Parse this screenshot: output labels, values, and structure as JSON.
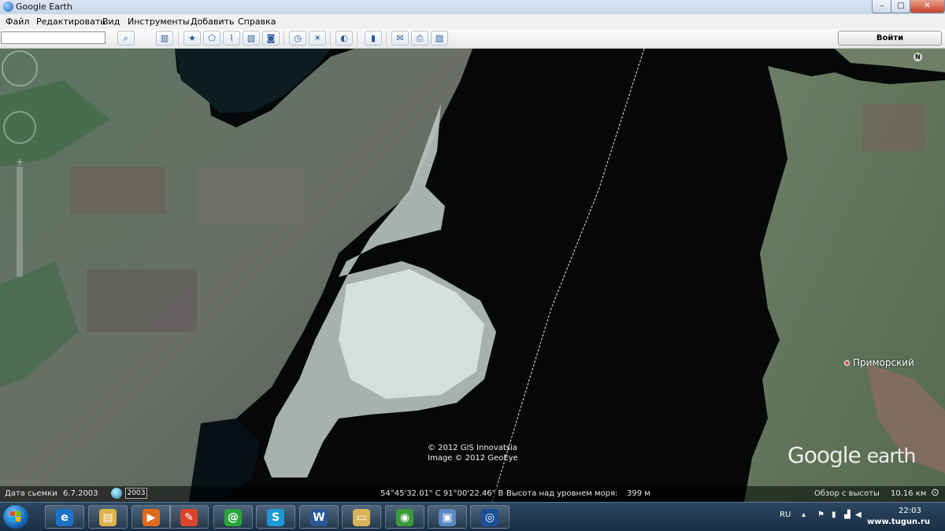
{
  "window": {
    "title": "Google Earth",
    "controls": {
      "minimize": "–",
      "maximize": "□",
      "close": "✕"
    }
  },
  "menu": [
    "Файл",
    "Редактировать",
    "Вид",
    "Инструменты",
    "Добавить",
    "Справка"
  ],
  "toolbar": {
    "search_value": "",
    "login_label": "Войти",
    "icons": [
      "search-icon",
      "sidebar-icon",
      "placemark-icon",
      "polygon-icon",
      "path-icon",
      "image-overlay-icon",
      "record-tour-icon",
      "historical-imagery-icon",
      "sunlight-icon",
      "planets-icon",
      "ruler-icon",
      "email-icon",
      "print-icon",
      "save-image-icon"
    ]
  },
  "map": {
    "copyright": [
      "© 2012 GIS Innovatsia",
      "Image © 2012 GeoEye"
    ],
    "place_label": "Приморский",
    "logo_main": "Google",
    "logo_sub": "earth",
    "north_label": "N"
  },
  "status": {
    "date_label": "Дата сьемки",
    "date_value": "6.7.2003",
    "year": "2003",
    "coordinates": "54°45'32.01\" С  91°00'22.46\" В",
    "elevation_label": "Высота над уровнем моря:",
    "elevation_value": "399 м",
    "eye_alt_label": "Обзор с высоты",
    "eye_alt_value": "10.16 км"
  },
  "taskbar": {
    "apps": [
      {
        "name": "ie",
        "glyph": "e",
        "color": "#1e73c9"
      },
      {
        "name": "explorer",
        "glyph": "▤",
        "color": "#e0b24a"
      },
      {
        "name": "media-player",
        "glyph": "▶",
        "color": "#e26b1c"
      },
      {
        "name": "paint",
        "glyph": "✎",
        "color": "#d9452b"
      },
      {
        "name": "icq",
        "glyph": "@",
        "color": "#2aa63a"
      },
      {
        "name": "skype",
        "glyph": "S",
        "color": "#1c9ad6"
      },
      {
        "name": "word",
        "glyph": "W",
        "color": "#2b5796"
      },
      {
        "name": "folder",
        "glyph": "▭",
        "color": "#d9b35a"
      },
      {
        "name": "chrome",
        "glyph": "◉",
        "color": "#3b9b3b"
      },
      {
        "name": "image-viewer",
        "glyph": "▣",
        "color": "#5a8ac2"
      },
      {
        "name": "google-earth",
        "glyph": "◎",
        "color": "#1a4f9a"
      }
    ],
    "lang": "RU",
    "time": "22:03"
  },
  "watermark": "www.tugun.ru"
}
